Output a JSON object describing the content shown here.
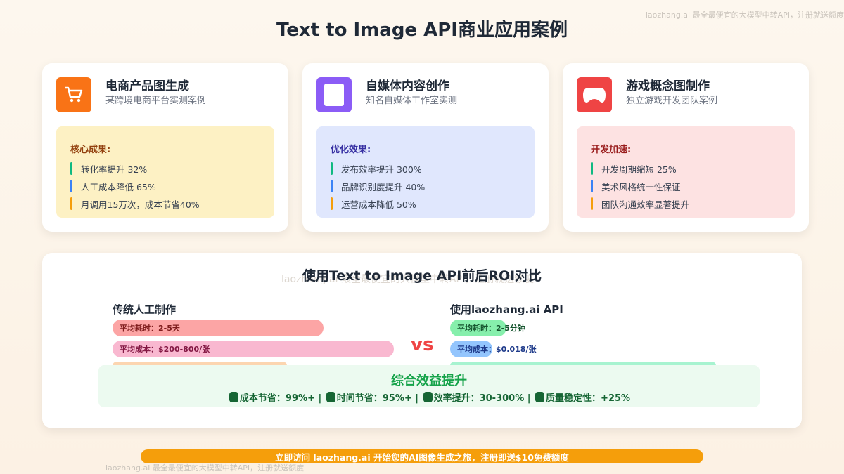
{
  "page": {
    "title": "Text to Image API商业应用案例",
    "watermark": "laozhang.ai 最全最便宜的大模型中转API，注册就送额度"
  },
  "cards": [
    {
      "title": "电商产品图生成",
      "subtitle": "某跨境电商平台实测案例",
      "icon": "shopping-cart-icon",
      "icon_color": "#f97316",
      "box_color": "#fdf1c4",
      "box_title": "核心成果:",
      "box_title_color": "#92400e",
      "items": [
        "转化率提升 32%",
        "人工成本降低 65%",
        "月调用15万次，成本节省40%"
      ]
    },
    {
      "title": "自媒体内容创作",
      "subtitle": "知名自媒体工作室实测",
      "icon": "document-icon",
      "icon_color": "#8b5cf6",
      "box_color": "#e0e7fd",
      "box_title": "优化效果:",
      "box_title_color": "#3730a3",
      "items": [
        "发布效率提升 300%",
        "品牌识别度提升 40%",
        "运营成本降低 50%"
      ]
    },
    {
      "title": "游戏概念图制作",
      "subtitle": "独立游戏开发团队案例",
      "icon": "gamepad-icon",
      "icon_color": "#ef4444",
      "box_color": "#fde2e2",
      "box_title": "开发加速:",
      "box_title_color": "#991b1b",
      "items": [
        "开发周期缩短 25%",
        "美术风格统一性保证",
        "团队沟通效率显著提升"
      ]
    }
  ],
  "item_marker_colors": [
    "#10b981",
    "#3b82f6",
    "#f59e0b"
  ],
  "roi": {
    "title": "使用Text to Image API前后ROI对比",
    "ghost_watermark": "laozhang.ai 最全最便宜的大模型中转API，注册就送额度",
    "vs_label": "vs",
    "traditional": {
      "title": "传统人工制作",
      "time": "平均耗时：2-5天",
      "cost": "平均成本：$200-800/张"
    },
    "api": {
      "title": "使用laozhang.ai API",
      "time_label": "平均耗时：",
      "time_value": "2-5分钟",
      "cost_label": "平均成本：",
      "cost_value": "$0.018/张"
    },
    "summary": {
      "title": "综合效益提升",
      "items": [
        {
          "icon": "money-bag-icon",
          "text": "成本节省：99%+"
        },
        {
          "icon": "alarm-clock-icon",
          "text": "时间节省：95%+"
        },
        {
          "icon": "chart-icon",
          "text": "效率提升：30-300%"
        },
        {
          "icon": "check-icon",
          "text": "质量稳定性：+25%"
        }
      ],
      "separator": "|"
    }
  },
  "cta": {
    "text": "立即访问 laozhang.ai 开始您的AI图像生成之旅，注册即送$10免费额度"
  }
}
